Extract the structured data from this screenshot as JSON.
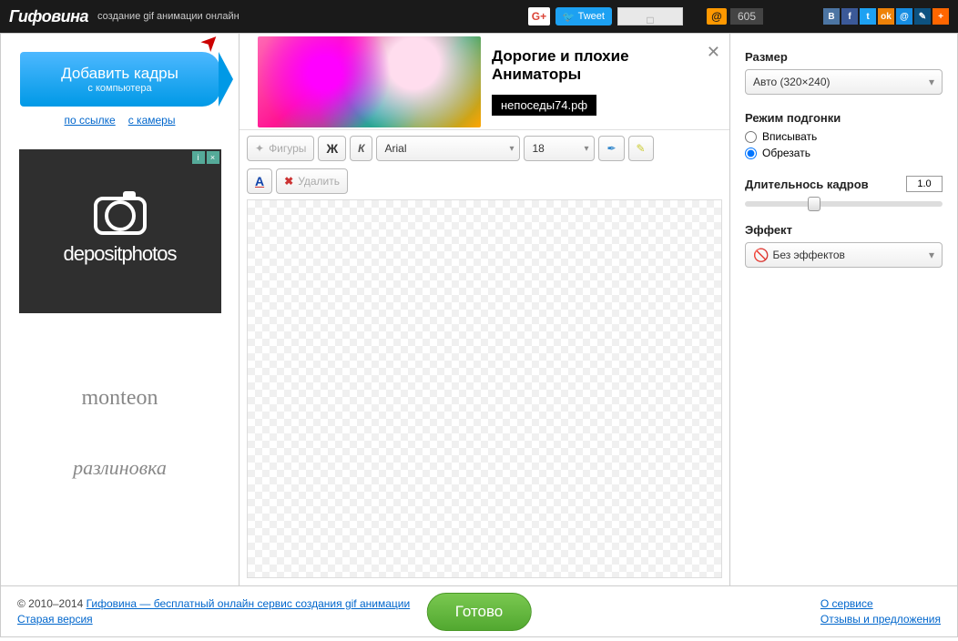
{
  "header": {
    "logo": "Гифовина",
    "tagline": "создание gif анимации онлайн",
    "gplus": "G+",
    "tweet": "Tweet",
    "counter": "605"
  },
  "leftCol": {
    "addButton": {
      "title": "Добавить кадры",
      "sub": "с компьютера"
    },
    "links": {
      "byLink": "по ссылке",
      "fromCamera": "с камеры"
    },
    "ad": {
      "brand": "depositphotos"
    },
    "promo1": "monteon",
    "promo2": "разлиновка"
  },
  "banner": {
    "title": "Дорогие и плохие Аниматоры",
    "domain": "непоседы74.рф"
  },
  "toolbar": {
    "shapes": "Фигуры",
    "font": "Arial",
    "fontSize": "18",
    "delete": "Удалить"
  },
  "rightPanel": {
    "sizeLabel": "Размер",
    "sizeValue": "Авто (320×240)",
    "fitLabel": "Режим подгонки",
    "fitInscribe": "Вписывать",
    "fitCrop": "Обрезать",
    "fitSelected": "crop",
    "durationLabel": "Длительнось кадров",
    "durationValue": "1.0",
    "effectLabel": "Эффект",
    "effectValue": "Без эффектов"
  },
  "footer": {
    "copyright": "© 2010–2014 ",
    "serviceLink": "Гифовина — бесплатный онлайн сервис создания gif анимации",
    "oldVersion": "Старая версия",
    "ready": "Готово",
    "about": "О сервисе",
    "feedback": "Отзывы и предложения"
  }
}
